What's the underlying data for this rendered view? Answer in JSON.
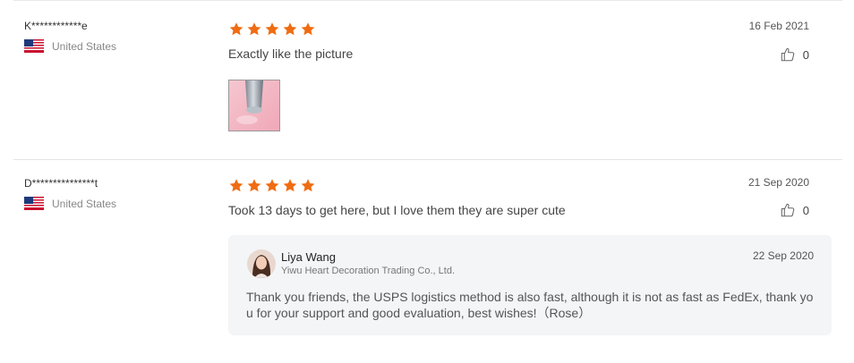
{
  "colors": {
    "star": "#f06c12",
    "reply_bg": "#f4f5f7",
    "divider": "#e5e5e5"
  },
  "reviews": [
    {
      "username": "K************e",
      "country": "United States",
      "flag_icon": "us-flag-icon",
      "rating": 5,
      "text": "Exactly like the picture",
      "date": "16 Feb 2021",
      "likes": "0",
      "has_photo": true
    },
    {
      "username": "D***************t",
      "country": "United States",
      "flag_icon": "us-flag-icon",
      "rating": 5,
      "text": "Took 13 days to get here, but I love them they are super cute",
      "date": "21 Sep 2020",
      "likes": "0",
      "reply": {
        "name": "Liya Wang",
        "company": "Yiwu Heart Decoration Trading Co., Ltd.",
        "date": "22 Sep 2020",
        "text": "Thank you friends, the USPS logistics method is also fast, although it is not as fast as FedEx, thank you for your support and good evaluation, best wishes!（Rose）"
      }
    }
  ]
}
